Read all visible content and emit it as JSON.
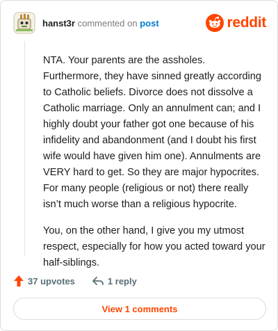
{
  "header": {
    "username": "hanst3r",
    "action_text": "commented on",
    "post_link": "post",
    "brand_name": "reddit"
  },
  "comment": {
    "paragraphs": [
      "NTA. Your parents are the assholes. Furthermore, they have sinned greatly according to Catholic beliefs. Divorce does not dissolve a Catholic marriage. Only an annulment can; and I highly doubt your father got one because of his infidelity and abandonment (and I doubt his first wife would have given him one). Annulments are VERY hard to get. So they are major hypocrites. For many people (religious or not) there really isn’t much worse than a religious hypocrite.",
      "You, on the other hand, I give you my utmost respect, especially for how you acted toward your half-siblings."
    ]
  },
  "actions": {
    "upvotes_label": "37 upvotes",
    "reply_label": "1 reply"
  },
  "footer": {
    "view_comments_label": "View 1 comments"
  },
  "colors": {
    "brand": "#ff4500",
    "link": "#0079d3",
    "muted": "#576f76"
  },
  "icons": {
    "avatar": "snoo-avatar-icon",
    "logo": "reddit-logo-icon",
    "upvote": "upvote-arrow-icon",
    "reply": "reply-arrow-icon"
  }
}
